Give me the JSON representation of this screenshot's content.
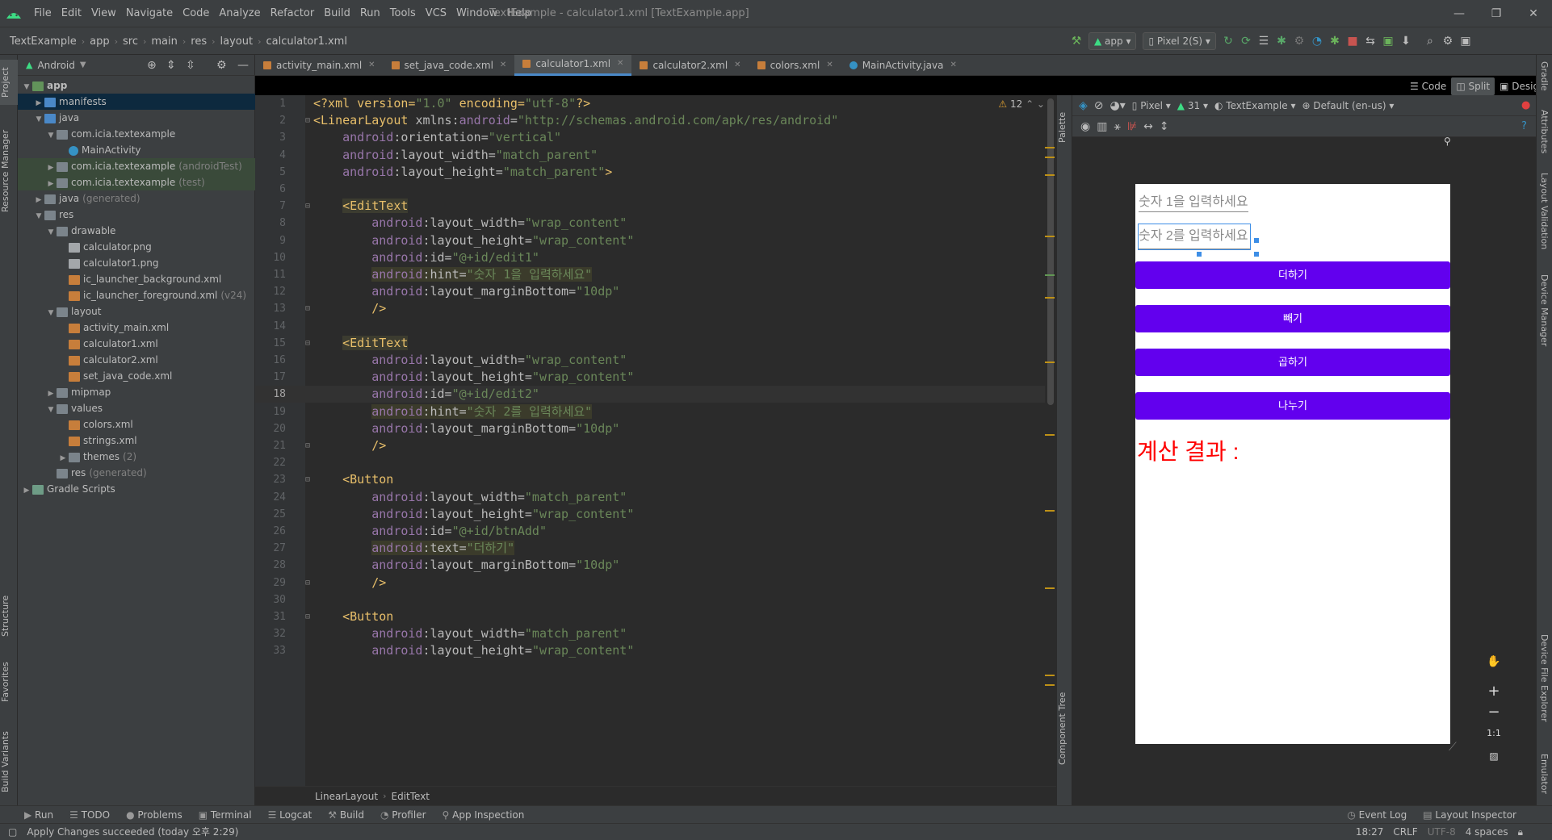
{
  "window": {
    "title": "TextExample - calculator1.xml [TextExample.app]",
    "menu": [
      "File",
      "Edit",
      "View",
      "Navigate",
      "Code",
      "Analyze",
      "Refactor",
      "Build",
      "Run",
      "Tools",
      "VCS",
      "Window",
      "Help"
    ],
    "controls": [
      "—",
      "❐",
      "✕"
    ]
  },
  "nav": {
    "crumbs": [
      "TextExample",
      "app",
      "src",
      "main",
      "res",
      "layout",
      "calculator1.xml"
    ],
    "run_config": "app",
    "device": "Pixel 2(S)"
  },
  "left_strip": {
    "top": [
      "Project",
      "Resource Manager"
    ],
    "bottom": [
      "Structure",
      "Favorites",
      "Build Variants"
    ]
  },
  "project": {
    "view_selector": "Android",
    "tree": [
      {
        "depth": 0,
        "arrow": "▼",
        "icon": "folder-green",
        "label": "app",
        "muted": "",
        "bold": true
      },
      {
        "depth": 1,
        "arrow": "▶",
        "icon": "folder-blue",
        "label": "manifests",
        "muted": "",
        "selected": "blue"
      },
      {
        "depth": 1,
        "arrow": "▼",
        "icon": "folder-blue",
        "label": "java",
        "muted": ""
      },
      {
        "depth": 2,
        "arrow": "▼",
        "icon": "folder",
        "label": "com.icia.textexample",
        "muted": ""
      },
      {
        "depth": 3,
        "arrow": "",
        "icon": "class",
        "label": "MainActivity",
        "muted": ""
      },
      {
        "depth": 2,
        "arrow": "▶",
        "icon": "folder",
        "label": "com.icia.textexample",
        "muted": "(androidTest)",
        "selected": "green"
      },
      {
        "depth": 2,
        "arrow": "▶",
        "icon": "folder",
        "label": "com.icia.textexample",
        "muted": "(test)",
        "selected": "green"
      },
      {
        "depth": 1,
        "arrow": "▶",
        "icon": "folder",
        "label": "java",
        "muted": "(generated)"
      },
      {
        "depth": 1,
        "arrow": "▼",
        "icon": "folder",
        "label": "res",
        "muted": ""
      },
      {
        "depth": 2,
        "arrow": "▼",
        "icon": "folder",
        "label": "drawable",
        "muted": ""
      },
      {
        "depth": 3,
        "arrow": "",
        "icon": "file-img",
        "label": "calculator.png",
        "muted": ""
      },
      {
        "depth": 3,
        "arrow": "",
        "icon": "file-img",
        "label": "calculator1.png",
        "muted": ""
      },
      {
        "depth": 3,
        "arrow": "",
        "icon": "file-xml",
        "label": "ic_launcher_background.xml",
        "muted": ""
      },
      {
        "depth": 3,
        "arrow": "",
        "icon": "file-xml",
        "label": "ic_launcher_foreground.xml",
        "muted": "(v24)"
      },
      {
        "depth": 2,
        "arrow": "▼",
        "icon": "folder",
        "label": "layout",
        "muted": ""
      },
      {
        "depth": 3,
        "arrow": "",
        "icon": "file-xml",
        "label": "activity_main.xml",
        "muted": ""
      },
      {
        "depth": 3,
        "arrow": "",
        "icon": "file-xml",
        "label": "calculator1.xml",
        "muted": ""
      },
      {
        "depth": 3,
        "arrow": "",
        "icon": "file-xml",
        "label": "calculator2.xml",
        "muted": ""
      },
      {
        "depth": 3,
        "arrow": "",
        "icon": "file-xml",
        "label": "set_java_code.xml",
        "muted": ""
      },
      {
        "depth": 2,
        "arrow": "▶",
        "icon": "folder",
        "label": "mipmap",
        "muted": ""
      },
      {
        "depth": 2,
        "arrow": "▼",
        "icon": "folder",
        "label": "values",
        "muted": ""
      },
      {
        "depth": 3,
        "arrow": "",
        "icon": "file-xml",
        "label": "colors.xml",
        "muted": ""
      },
      {
        "depth": 3,
        "arrow": "",
        "icon": "file-xml",
        "label": "strings.xml",
        "muted": ""
      },
      {
        "depth": 3,
        "arrow": "▶",
        "icon": "folder",
        "label": "themes",
        "muted": "(2)"
      },
      {
        "depth": 2,
        "arrow": "",
        "icon": "folder",
        "label": "res",
        "muted": "(generated)"
      },
      {
        "depth": 0,
        "arrow": "▶",
        "icon": "gradle",
        "label": "Gradle Scripts",
        "muted": ""
      }
    ]
  },
  "tabs": [
    {
      "label": "activity_main.xml",
      "type": "xml",
      "active": false
    },
    {
      "label": "set_java_code.xml",
      "type": "xml",
      "active": false
    },
    {
      "label": "calculator1.xml",
      "type": "xml",
      "active": true
    },
    {
      "label": "calculator2.xml",
      "type": "xml",
      "active": false
    },
    {
      "label": "colors.xml",
      "type": "xml",
      "active": false
    },
    {
      "label": "MainActivity.java",
      "type": "java",
      "active": false
    }
  ],
  "view_modes": [
    "Code",
    "Split",
    "Design"
  ],
  "editor": {
    "warning_count": "12",
    "current_line": 18,
    "lines": [
      {
        "n": "1",
        "fold": "",
        "segs": [
          [
            "pi",
            "<?xml version="
          ],
          [
            "val",
            "\"1.0\""
          ],
          [
            "pi",
            " encoding="
          ],
          [
            "val",
            "\"utf-8\""
          ],
          [
            "pi",
            "?>"
          ]
        ]
      },
      {
        "n": "2",
        "fold": "⊟",
        "segs": [
          [
            "tag",
            "<LinearLayout "
          ],
          [
            "attr",
            "xmlns:"
          ],
          [
            "ns",
            "android"
          ],
          [
            "attr",
            "="
          ],
          [
            "val",
            "\"http://schemas.android.com/apk/res/android\""
          ]
        ]
      },
      {
        "n": "3",
        "fold": "",
        "segs": [
          [
            "plain",
            "    "
          ],
          [
            "ns",
            "android"
          ],
          [
            "attr",
            ":orientation="
          ],
          [
            "val",
            "\"vertical\""
          ]
        ]
      },
      {
        "n": "4",
        "fold": "",
        "segs": [
          [
            "plain",
            "    "
          ],
          [
            "ns",
            "android"
          ],
          [
            "attr",
            ":layout_width="
          ],
          [
            "val",
            "\"match_parent\""
          ]
        ]
      },
      {
        "n": "5",
        "fold": "",
        "segs": [
          [
            "plain",
            "    "
          ],
          [
            "ns",
            "android"
          ],
          [
            "attr",
            ":layout_height="
          ],
          [
            "val",
            "\"match_parent\""
          ],
          [
            "tag",
            ">"
          ]
        ]
      },
      {
        "n": "6",
        "fold": "",
        "segs": []
      },
      {
        "n": "7",
        "fold": "⊟",
        "segs": [
          [
            "plain",
            "    "
          ],
          [
            "tag-hl",
            "<EditText"
          ]
        ]
      },
      {
        "n": "8",
        "fold": "",
        "segs": [
          [
            "plain",
            "        "
          ],
          [
            "ns",
            "android"
          ],
          [
            "attr",
            ":layout_width="
          ],
          [
            "val",
            "\"wrap_content\""
          ]
        ]
      },
      {
        "n": "9",
        "fold": "",
        "segs": [
          [
            "plain",
            "        "
          ],
          [
            "ns",
            "android"
          ],
          [
            "attr",
            ":layout_height="
          ],
          [
            "val",
            "\"wrap_content\""
          ]
        ]
      },
      {
        "n": "10",
        "fold": "",
        "segs": [
          [
            "plain",
            "        "
          ],
          [
            "ns",
            "android"
          ],
          [
            "attr",
            ":id="
          ],
          [
            "val",
            "\"@+id/edit1\""
          ]
        ]
      },
      {
        "n": "11",
        "fold": "",
        "segs": [
          [
            "plain",
            "        "
          ],
          [
            "ns-hl",
            "android"
          ],
          [
            "attr-hl",
            ":hint="
          ],
          [
            "val-hl",
            "\"숫자 1을 입력하세요\""
          ]
        ]
      },
      {
        "n": "12",
        "fold": "",
        "segs": [
          [
            "plain",
            "        "
          ],
          [
            "ns",
            "android"
          ],
          [
            "attr",
            ":layout_marginBottom="
          ],
          [
            "val",
            "\"10dp\""
          ]
        ]
      },
      {
        "n": "13",
        "fold": "⊟",
        "segs": [
          [
            "plain",
            "        "
          ],
          [
            "tag",
            "/>"
          ]
        ]
      },
      {
        "n": "14",
        "fold": "",
        "segs": []
      },
      {
        "n": "15",
        "fold": "⊟",
        "segs": [
          [
            "plain",
            "    "
          ],
          [
            "tag-hl",
            "<EditText"
          ]
        ]
      },
      {
        "n": "16",
        "fold": "",
        "segs": [
          [
            "plain",
            "        "
          ],
          [
            "ns",
            "android"
          ],
          [
            "attr",
            ":layout_width="
          ],
          [
            "val",
            "\"wrap_content\""
          ]
        ]
      },
      {
        "n": "17",
        "fold": "",
        "segs": [
          [
            "plain",
            "        "
          ],
          [
            "ns",
            "android"
          ],
          [
            "attr",
            ":layout_height="
          ],
          [
            "val",
            "\"wrap_content\""
          ]
        ]
      },
      {
        "n": "18",
        "fold": "",
        "segs": [
          [
            "plain",
            "        "
          ],
          [
            "ns",
            "android"
          ],
          [
            "attr",
            ":id="
          ],
          [
            "val",
            "\"@+id/edit2\""
          ]
        ]
      },
      {
        "n": "19",
        "fold": "",
        "segs": [
          [
            "plain",
            "        "
          ],
          [
            "ns-hl",
            "android"
          ],
          [
            "attr-hl",
            ":hint="
          ],
          [
            "val-hl",
            "\"숫자 2를 입력하세요\""
          ]
        ]
      },
      {
        "n": "20",
        "fold": "",
        "segs": [
          [
            "plain",
            "        "
          ],
          [
            "ns",
            "android"
          ],
          [
            "attr",
            ":layout_marginBottom="
          ],
          [
            "val",
            "\"10dp\""
          ]
        ]
      },
      {
        "n": "21",
        "fold": "⊟",
        "segs": [
          [
            "plain",
            "        "
          ],
          [
            "tag",
            "/>"
          ]
        ]
      },
      {
        "n": "22",
        "fold": "",
        "segs": []
      },
      {
        "n": "23",
        "fold": "⊟",
        "segs": [
          [
            "plain",
            "    "
          ],
          [
            "tag",
            "<Button"
          ]
        ]
      },
      {
        "n": "24",
        "fold": "",
        "segs": [
          [
            "plain",
            "        "
          ],
          [
            "ns",
            "android"
          ],
          [
            "attr",
            ":layout_width="
          ],
          [
            "val",
            "\"match_parent\""
          ]
        ]
      },
      {
        "n": "25",
        "fold": "",
        "segs": [
          [
            "plain",
            "        "
          ],
          [
            "ns",
            "android"
          ],
          [
            "attr",
            ":layout_height="
          ],
          [
            "val",
            "\"wrap_content\""
          ]
        ]
      },
      {
        "n": "26",
        "fold": "",
        "segs": [
          [
            "plain",
            "        "
          ],
          [
            "ns",
            "android"
          ],
          [
            "attr",
            ":id="
          ],
          [
            "val",
            "\"@+id/btnAdd\""
          ]
        ]
      },
      {
        "n": "27",
        "fold": "",
        "segs": [
          [
            "plain",
            "        "
          ],
          [
            "ns-hl",
            "android"
          ],
          [
            "attr-hl",
            ":text="
          ],
          [
            "val-hl",
            "\"더하기\""
          ]
        ]
      },
      {
        "n": "28",
        "fold": "",
        "segs": [
          [
            "plain",
            "        "
          ],
          [
            "ns",
            "android"
          ],
          [
            "attr",
            ":layout_marginBottom="
          ],
          [
            "val",
            "\"10dp\""
          ]
        ]
      },
      {
        "n": "29",
        "fold": "⊟",
        "segs": [
          [
            "plain",
            "        "
          ],
          [
            "tag",
            "/>"
          ]
        ]
      },
      {
        "n": "30",
        "fold": "",
        "segs": []
      },
      {
        "n": "31",
        "fold": "⊟",
        "segs": [
          [
            "plain",
            "    "
          ],
          [
            "tag",
            "<Button"
          ]
        ]
      },
      {
        "n": "32",
        "fold": "",
        "segs": [
          [
            "plain",
            "        "
          ],
          [
            "ns",
            "android"
          ],
          [
            "attr",
            ":layout_width="
          ],
          [
            "val",
            "\"match_parent\""
          ]
        ]
      },
      {
        "n": "33",
        "fold": "",
        "segs": [
          [
            "plain",
            "        "
          ],
          [
            "ns",
            "android"
          ],
          [
            "attr",
            ":layout_height="
          ],
          [
            "val",
            "\"wrap_content\""
          ]
        ]
      }
    ],
    "breadcrumb": [
      "LinearLayout",
      "EditText"
    ]
  },
  "palette_strip": [
    "Palette",
    "Component Tree"
  ],
  "design": {
    "toolbar1": {
      "device": "Pixel",
      "api": "31",
      "theme": "TextExample",
      "locale": "Default (en-us)"
    },
    "preview": {
      "edit1_hint": "숫자 1을 입력하세요",
      "edit2_hint": "숫자 2를 입력하세요",
      "buttons": [
        "더하기",
        "빼기",
        "곱하기",
        "나누기"
      ],
      "result": "계산 결과 :",
      "button_color": "#6200ee",
      "result_color": "#ff0000"
    },
    "zoom": [
      "✋",
      "+",
      "−",
      "1:1"
    ]
  },
  "right_strip": [
    "Gradle",
    "Attributes",
    "Layout Validation",
    "Device Manager",
    "Device File Explorer",
    "Emulator"
  ],
  "bottom_tools": {
    "left": [
      "Run",
      "TODO",
      "Problems",
      "Terminal",
      "Logcat",
      "Build",
      "Profiler",
      "App Inspection"
    ],
    "right": [
      "Event Log",
      "Layout Inspector"
    ]
  },
  "status": {
    "message": "Apply Changes succeeded (today 오후 2:29)",
    "position": "18:27",
    "line_sep": "CRLF",
    "encoding": "UTF-8",
    "indent": "4 spaces"
  }
}
